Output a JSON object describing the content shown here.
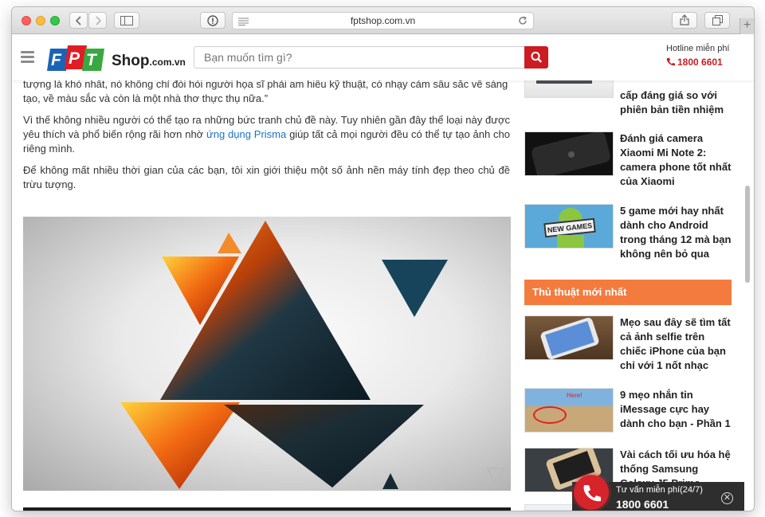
{
  "browser": {
    "url": "fptshop.com.vn"
  },
  "header": {
    "logo_text": "FPT",
    "shop_text": "Shop",
    "shop_domain": ".com.vn",
    "search_placeholder": "Bạn muốn tìm gì?",
    "hotline_label": "Hotline miễn phí",
    "hotline_number": "1800 6601"
  },
  "article": {
    "quote_line1": "tượng là khó nhất, nó không chỉ đòi hỏi người họa sĩ phải am hiểu kỹ thuật, có nhạy cảm sâu sắc về sáng",
    "quote_line2": "tạo, về màu sắc và còn là một nhà thơ thực thụ nữa.”",
    "para2_a": "Vì thế không nhiều người có thể tạo ra những bức tranh chủ đề này. Tuy nhiên gần đây thể loại này được yêu thích và phổ biến rộng rãi hơn nhờ ",
    "para2_link": "ứng dụng Prisma",
    "para2_b": " giúp tất cả mọi người đều có thể tự tạo ảnh cho riêng mình.",
    "para3": "Để không mất nhiều thời gian của các bạn, tôi xin giới thiệu một số ảnh nền máy tính đẹp theo chủ đề trừu tượng."
  },
  "sidebar": {
    "related": [
      {
        "title": "cấp đáng giá so với phiên bản tiền nhiệm"
      },
      {
        "title": "Đánh giá camera Xiaomi Mi Note 2: camera phone tốt nhất của Xiaomi"
      },
      {
        "title": "5 game mới hay nhất dành cho Android trong tháng 12 mà bạn không nên bỏ qua",
        "thumb_text": "NEW GAMES"
      }
    ],
    "section_title": "Thủ thuật mới nhất",
    "tips": [
      {
        "title": "Mẹo sau đây sẽ tìm tất cả ảnh selfie trên chiếc iPhone của bạn chỉ với 1 nốt nhạc"
      },
      {
        "title": "9 mẹo nhắn tin iMessage cực hay dành cho bạn - Phần 1",
        "thumb_text": "Here!"
      },
      {
        "title": "Vài cách tối ưu hóa hệ thống Samsung Galaxy J5 Prime"
      }
    ]
  },
  "call_widget": {
    "label": "Tư vấn miễn phí(24/7)",
    "number": "1800 6601"
  },
  "colors": {
    "brand_red": "#cb1c22",
    "accent_orange": "#f47b3e",
    "link_blue": "#1a73c9"
  }
}
